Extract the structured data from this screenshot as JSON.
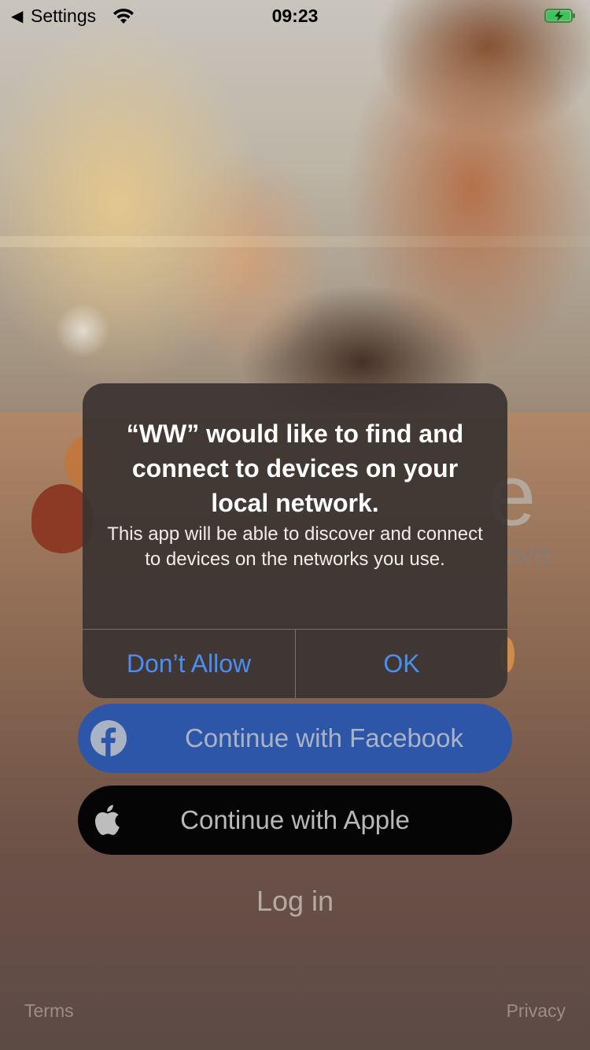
{
  "status_bar": {
    "back_app": "Settings",
    "time": "09:23"
  },
  "dialog": {
    "title": "“WW” would like to find and connect to devices on your local network.",
    "message": "This app will be able to discover and connect to devices on the networks you use.",
    "deny_label": "Don’t Allow",
    "ok_label": "OK"
  },
  "auth": {
    "facebook_label": "Continue with Facebook",
    "apple_label": "Continue with Apple",
    "login_label": "Log in"
  },
  "footer": {
    "terms_label": "Terms",
    "privacy_label": "Privacy"
  },
  "logo": {
    "partial_text_big": "e",
    "partial_text_small": "ove"
  },
  "colors": {
    "alert_button": "#4a8ef3",
    "facebook_button": "#2e56a8",
    "apple_button": "#050505"
  },
  "icons": [
    "back-arrow-icon",
    "wifi-icon",
    "battery-charging-icon",
    "facebook-icon",
    "apple-icon"
  ]
}
